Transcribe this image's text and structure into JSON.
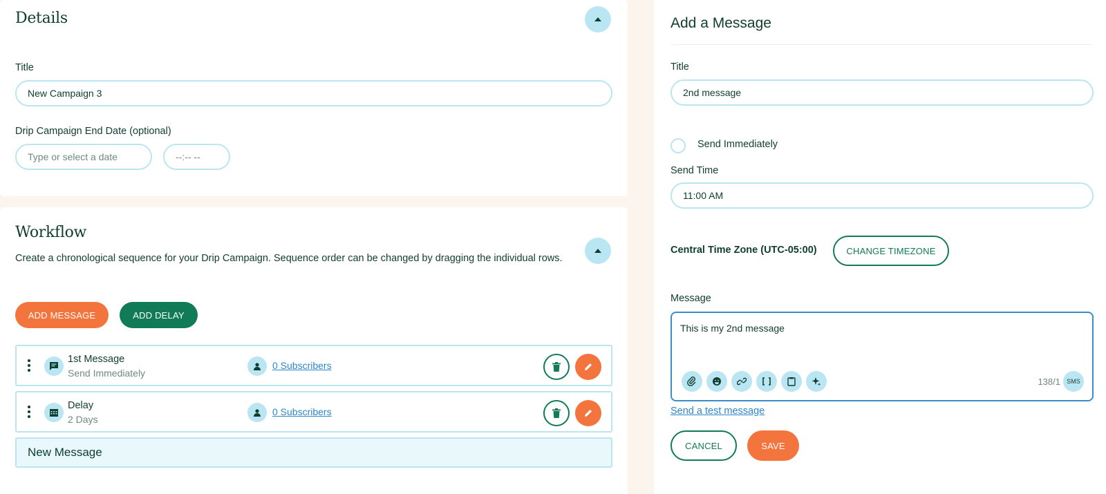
{
  "details": {
    "title": "Details",
    "title_label": "Title",
    "title_value": "New Campaign 3",
    "end_date_label": "Drip Campaign End Date (optional)",
    "date_placeholder": "Type or select a date",
    "time_placeholder": "--:-- --"
  },
  "workflow": {
    "title": "Workflow",
    "description": "Create a chronological sequence for your Drip Campaign. Sequence order can be changed by dragging the individual rows.",
    "add_message_label": "ADD MESSAGE",
    "add_delay_label": "ADD DELAY",
    "rows": [
      {
        "name": "1st Message",
        "sub": "Send Immediately",
        "subscribers": "0 Subscribers",
        "icon": "chat-icon"
      },
      {
        "name": "Delay",
        "sub": "2 Days",
        "subscribers": "0 Subscribers",
        "icon": "calendar-icon"
      }
    ],
    "new_row_label": "New Message"
  },
  "panel": {
    "title": "Add a Message",
    "title_label": "Title",
    "title_value": "2nd message",
    "send_immediately_label": "Send Immediately",
    "send_time_label": "Send Time",
    "send_time_value": "11:00 AM",
    "timezone_text": "Central Time Zone (UTC-05:00)",
    "change_timezone_label": "CHANGE TIMEZONE",
    "message_label": "Message",
    "message_value": "This is my 2nd message",
    "char_counter": "138/1",
    "sms_badge": "SMS",
    "test_link": "Send a test message",
    "cancel_label": "CANCEL",
    "save_label": "SAVE"
  },
  "colors": {
    "accent_orange": "#f3743d",
    "accent_green": "#117a57",
    "light_blue": "#b9e6f2",
    "text_dark": "#0f3d2e",
    "page_bg": "#fbf5ee"
  }
}
